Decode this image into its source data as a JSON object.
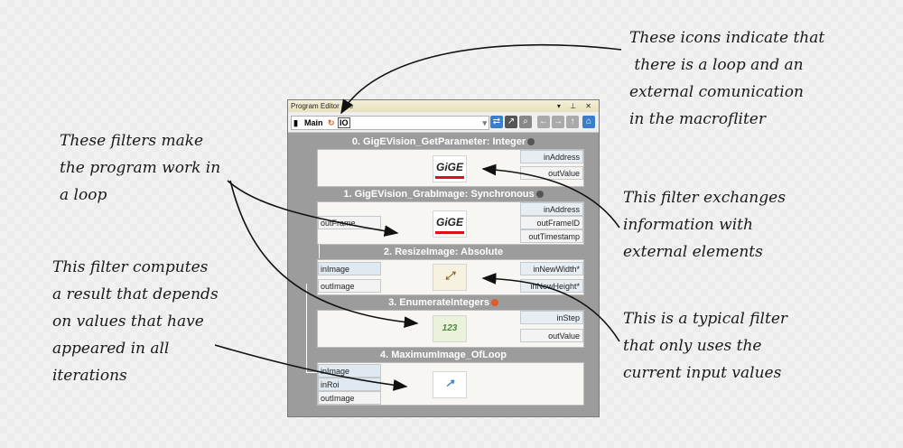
{
  "annotations": {
    "icons_note": "These icons indicate that\n there is a loop and an\nexternal comunication\nin the macrofliter",
    "loop_note": "These filters make\nthe program work in\na loop",
    "compute_note": "This filter computes\na result that depends\non values that have\nappeared in all\niterations",
    "exchange_note": "This filter exchanges\ninformation with\nexternal elements",
    "typical_note": "This is a typical filter\nthat only uses the\ncurrent input values"
  },
  "window": {
    "title": "Program Editor - Te",
    "toolbar": {
      "main_label": "Main",
      "io_label": "IO"
    }
  },
  "filters": [
    {
      "title": "0. GigEVision_GetParameter: Integer",
      "outputs": [
        "inAddress",
        "outValue"
      ],
      "logo": "GiGE"
    },
    {
      "title": "1. GigEVision_GrabImage: Synchronous",
      "inputs": [
        "outFrame"
      ],
      "outputs": [
        "inAddress",
        "outFrameID",
        "outTimestamp"
      ],
      "logo": "GiGE"
    },
    {
      "title": "2. ResizeImage: Absolute",
      "inputs": [
        "inImage",
        "outImage"
      ],
      "outputs": [
        "inNewWidth*",
        "inNewHeight*"
      ]
    },
    {
      "title": "3. EnumerateIntegers",
      "outputs": [
        "inStep",
        "outValue"
      ]
    },
    {
      "title": "4. MaximumImage_OfLoop",
      "inputs": [
        "inImage",
        "inRoi",
        "outImage"
      ]
    }
  ],
  "colors": {
    "loop_icon": "#e05a2b",
    "comm_icon": "#555555",
    "title_text": "#ffffff"
  }
}
